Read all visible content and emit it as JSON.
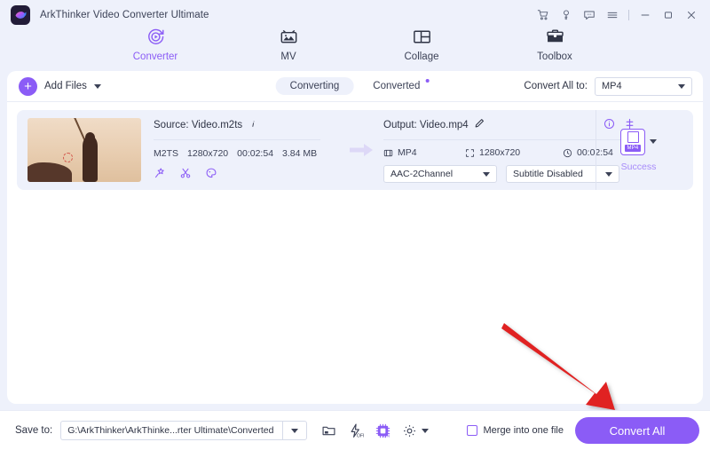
{
  "window": {
    "title": "ArkThinker Video Converter Ultimate",
    "logo_icon": "app-logo-icon",
    "controls": [
      {
        "name": "cart-icon",
        "glyph": "cart"
      },
      {
        "name": "key-icon",
        "glyph": "key"
      },
      {
        "name": "feedback-icon",
        "glyph": "chat"
      },
      {
        "name": "menu-icon",
        "glyph": "hamburger"
      },
      {
        "name": "minimize-button",
        "glyph": "minimize"
      },
      {
        "name": "maximize-button",
        "glyph": "maximize"
      },
      {
        "name": "close-button",
        "glyph": "close"
      }
    ]
  },
  "nav": {
    "items": [
      {
        "label": "Converter",
        "icon": "converter-icon",
        "active": true
      },
      {
        "label": "MV",
        "icon": "mv-icon",
        "active": false
      },
      {
        "label": "Collage",
        "icon": "collage-icon",
        "active": false
      },
      {
        "label": "Toolbox",
        "icon": "toolbox-icon",
        "active": false
      }
    ]
  },
  "toolbar": {
    "add_files_label": "Add Files",
    "tabs": [
      {
        "label": "Converting",
        "active": true,
        "badge": false
      },
      {
        "label": "Converted",
        "active": false,
        "badge": true
      }
    ],
    "convert_all_to_label": "Convert All to:",
    "convert_all_to_value": "MP4"
  },
  "file": {
    "source_label": "Source: Video.m2ts",
    "meta": {
      "format": "M2TS",
      "resolution": "1280x720",
      "duration": "00:02:54",
      "size": "3.84 MB"
    },
    "tools": [
      {
        "name": "enhance-icon"
      },
      {
        "name": "trim-icon"
      },
      {
        "name": "effects-icon"
      }
    ],
    "output_label": "Output: Video.mp4",
    "output_meta": {
      "format": "MP4",
      "resolution": "1280x720",
      "duration": "00:02:54"
    },
    "audio_track": "AAC-2Channel",
    "subtitle_track": "Subtitle Disabled",
    "format_badge": "MP4",
    "status": "Success"
  },
  "bottom": {
    "save_to_label": "Save to:",
    "save_to_path": "G:\\ArkThinker\\ArkThinke...rter Ultimate\\Converted",
    "icons": [
      {
        "name": "open-folder-icon",
        "label": ""
      },
      {
        "name": "high-speed-conversion-icon",
        "label": "OFF"
      },
      {
        "name": "gpu-acceleration-icon",
        "label": "ON"
      },
      {
        "name": "preferences-gear-icon",
        "label": ""
      }
    ],
    "merge_label": "Merge into one file",
    "merge_checked": false,
    "convert_all_label": "Convert All"
  },
  "colors": {
    "accent": "#8b5cf6",
    "accent_light": "#a78bfa",
    "bg": "#eef1fb",
    "panel": "#ffffff",
    "text": "#2f3445",
    "annotation": "#e02020"
  }
}
